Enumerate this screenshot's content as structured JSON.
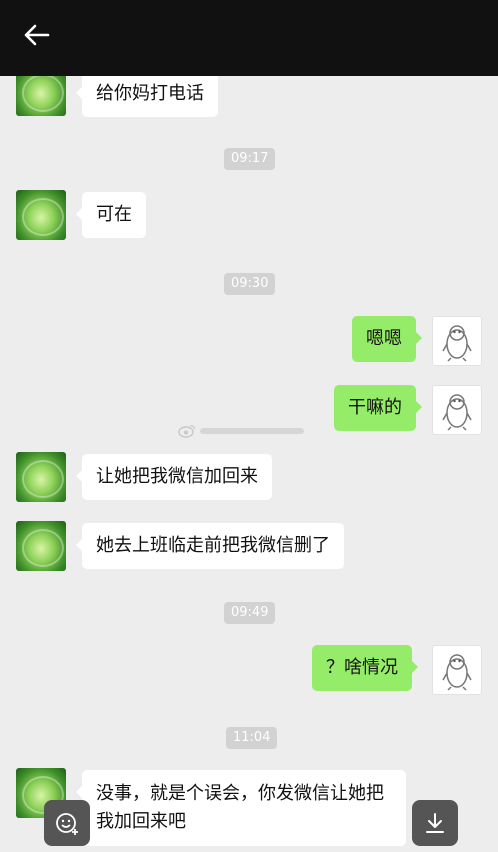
{
  "header": {
    "back_icon": "arrow-left-icon"
  },
  "messages": [
    {
      "side": "left",
      "text": "给你妈打电话"
    },
    {
      "side": "time",
      "text": "09:17"
    },
    {
      "side": "left",
      "text": "可在"
    },
    {
      "side": "time",
      "text": "09:30"
    },
    {
      "side": "right",
      "text": "嗯嗯"
    },
    {
      "side": "right",
      "text": "干嘛的"
    },
    {
      "side": "left",
      "text": "让她把我微信加回来"
    },
    {
      "side": "left",
      "text": "她去上班临走前把我微信删了"
    },
    {
      "side": "time",
      "text": "09:49"
    },
    {
      "side": "right",
      "text": "？啥情况"
    },
    {
      "side": "time",
      "text": "11:04"
    },
    {
      "side": "left",
      "text": "没事，就是个误会，你发微信让她把我加回来吧"
    }
  ],
  "watermark": {
    "icon": "weibo-icon"
  },
  "floating_buttons": {
    "left_icon": "add-emoji-icon",
    "right_icon": "download-icon"
  },
  "colors": {
    "background": "#ededed",
    "topbar": "#111111",
    "bubble_left": "#ffffff",
    "bubble_right": "#95ec69"
  }
}
